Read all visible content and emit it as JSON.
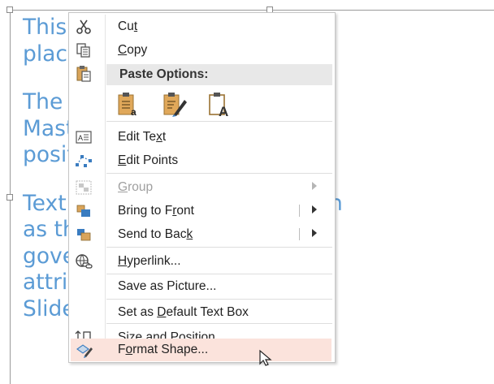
{
  "slide": {
    "paragraphs": [
      {
        "lines": [
          "This text box is not a",
          "placeholder."
        ]
      },
      {
        "lines": [
          "The settings of the Slide",
          "Master determines the",
          "position of this box."
        ]
      },
      {
        "lines": [
          "Text boxes, even though such",
          "as the ones on the left are",
          "governed by the position",
          "attributes defined in the",
          "Slide Master."
        ]
      }
    ]
  },
  "menu": {
    "items": [
      {
        "id": "cut",
        "pre": "Cu",
        "accel": "t",
        "post": "",
        "icon": "scissors-icon"
      },
      {
        "id": "copy",
        "pre": "",
        "accel": "C",
        "post": "opy",
        "icon": "copy-icon"
      },
      {
        "id": "edit-text",
        "pre": "Edit Te",
        "accel": "x",
        "post": "t",
        "icon": "edit-text-icon"
      },
      {
        "id": "edit-points",
        "pre": "",
        "accel": "E",
        "post": "dit Points",
        "icon": "edit-points-icon"
      },
      {
        "id": "group",
        "pre": "",
        "accel": "G",
        "post": "roup",
        "icon": "group-icon",
        "disabled": true,
        "submenu": true
      },
      {
        "id": "bring-to-front",
        "pre": "Bring to F",
        "accel": "r",
        "post": "ont",
        "icon": "bring-to-front-icon",
        "submenu": true
      },
      {
        "id": "send-to-back",
        "pre": "Send to Bac",
        "accel": "k",
        "post": "",
        "icon": "send-to-back-icon",
        "submenu": true
      },
      {
        "id": "hyperlink",
        "pre": "",
        "accel": "H",
        "post": "yperlink...",
        "icon": "hyperlink-icon"
      },
      {
        "id": "save-as-picture",
        "pre": "Save as Picture...",
        "accel": "",
        "post": "",
        "icon": ""
      },
      {
        "id": "set-default",
        "pre": "Set as ",
        "accel": "D",
        "post": "efault Text Box",
        "icon": ""
      },
      {
        "id": "size-position",
        "pre": "Si",
        "accel": "z",
        "post": "e and Position...",
        "icon": "size-position-icon"
      },
      {
        "id": "format-shape",
        "pre": "F",
        "accel": "o",
        "post": "rmat Shape...",
        "icon": "format-shape-icon",
        "hover": true
      }
    ],
    "paste_header": "Paste Options:",
    "paste_options": [
      "paste-use-destination-theme-icon",
      "paste-keep-source-formatting-icon",
      "paste-keep-text-only-icon"
    ]
  },
  "colors": {
    "slide_text": "#5b9bd5",
    "hover": "#fbe3dc",
    "header_bg": "#e8e8e8"
  }
}
